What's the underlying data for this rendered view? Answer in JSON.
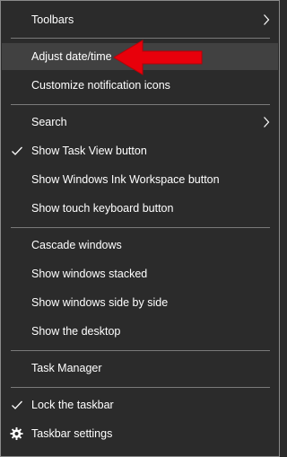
{
  "menu": {
    "toolbars": "Toolbars",
    "adjust_date_time": "Adjust date/time",
    "customize_notification_icons": "Customize notification icons",
    "search": "Search",
    "show_task_view_button": "Show Task View button",
    "show_windows_ink_button": "Show Windows Ink Workspace button",
    "show_touch_keyboard_button": "Show touch keyboard button",
    "cascade_windows": "Cascade windows",
    "show_windows_stacked": "Show windows stacked",
    "show_windows_side_by_side": "Show windows side by side",
    "show_the_desktop": "Show the desktop",
    "task_manager": "Task Manager",
    "lock_the_taskbar": "Lock the taskbar",
    "taskbar_settings": "Taskbar settings"
  },
  "state": {
    "hovered_item": "Adjust date/time",
    "checked_items": [
      "Show Task View button",
      "Lock the taskbar"
    ]
  },
  "icons": {
    "submenu": "chevron-right-icon",
    "checked": "checkmark-icon",
    "settings": "gear-icon",
    "annotation": "red-arrow-icon"
  },
  "colors": {
    "background": "#2b2b2b",
    "hover": "#414141",
    "text": "#ffffff",
    "separator": "#7a7a7a",
    "annotation_arrow": "#e8000b"
  }
}
